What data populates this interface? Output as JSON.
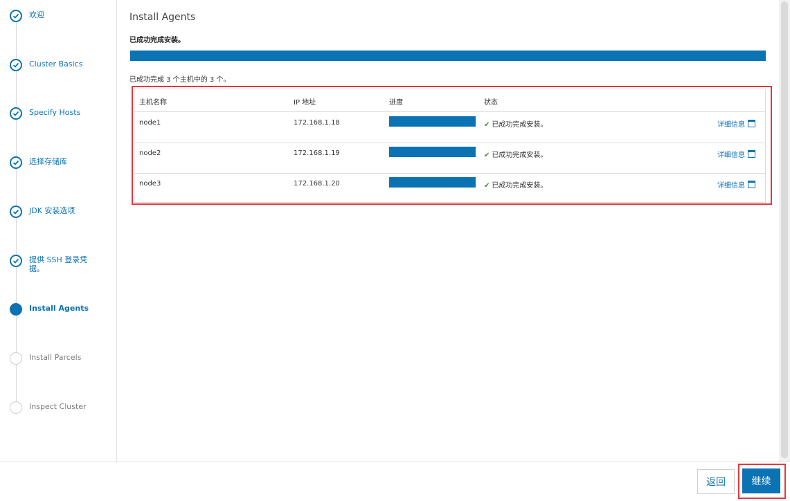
{
  "sidebar": {
    "steps": [
      {
        "label": "欢迎",
        "state": "done"
      },
      {
        "label": "Cluster Basics",
        "state": "done"
      },
      {
        "label": "Specify Hosts",
        "state": "done"
      },
      {
        "label": "选择存储库",
        "state": "done"
      },
      {
        "label": "JDK 安装选项",
        "state": "done"
      },
      {
        "label": "提供 SSH 登录凭据。",
        "state": "done"
      },
      {
        "label": "Install Agents",
        "state": "active"
      },
      {
        "label": "Install Parcels",
        "state": "todo"
      },
      {
        "label": "Inspect Cluster",
        "state": "todo"
      }
    ]
  },
  "main": {
    "title": "Install Agents",
    "success_text": "已成功完成安装。",
    "overall_progress": 1.0,
    "summary": "已成功完成 3 个主机中的 3 个。",
    "table": {
      "headers": [
        "主机名称",
        "IP 地址",
        "进度",
        "状态"
      ],
      "rows": [
        {
          "host": "node1",
          "ip": "172.168.1.18",
          "progress": 1.0,
          "status": "已成功完成安装。",
          "details": "详细信息"
        },
        {
          "host": "node2",
          "ip": "172.168.1.19",
          "progress": 1.0,
          "status": "已成功完成安装。",
          "details": "详细信息"
        },
        {
          "host": "node3",
          "ip": "172.168.1.20",
          "progress": 1.0,
          "status": "已成功完成安装。",
          "details": "详细信息"
        }
      ]
    }
  },
  "footer": {
    "back_label": "返回",
    "continue_label": "继续"
  },
  "colors": {
    "accent": "#0b72b3",
    "highlight": "#e0393e",
    "success": "#3c8d2f"
  },
  "icons": {
    "step_done": "check-circle-icon",
    "status": "check-icon",
    "details": "window-icon"
  }
}
